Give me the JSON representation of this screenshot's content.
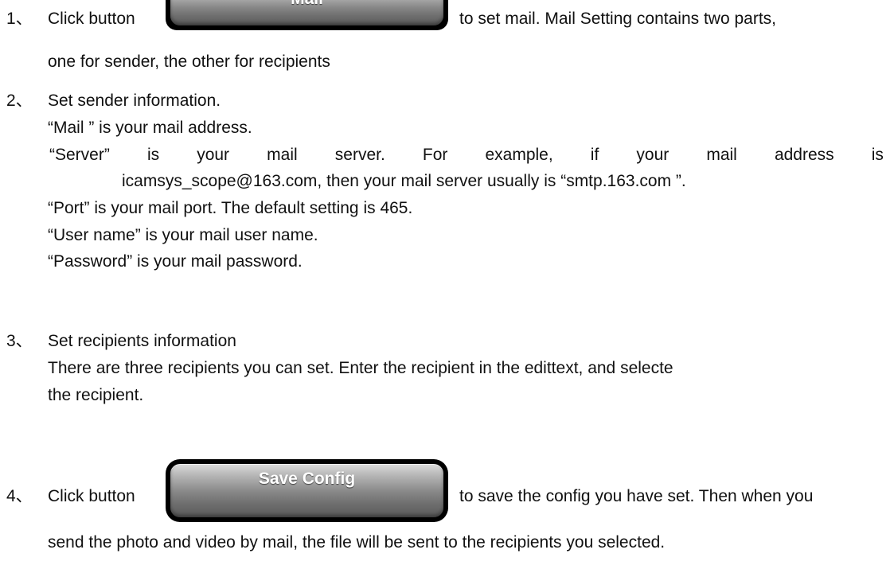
{
  "steps": [
    {
      "number": "1、",
      "lines": [
        "Click button",
        "to set mail. Mail Setting contains two parts,",
        "one for sender, the other for recipients"
      ],
      "button_label": "Mail"
    },
    {
      "number": "2、",
      "lines": [
        "Set sender information.",
        "“Mail ”   is your mail address.",
        "icamsys_scope@163.com, then your mail server usually is “smtp.163.com ”.",
        "“Port” is your mail port. The default setting is 465.",
        "“User name” is your mail user name.",
        "“Password” is your mail password."
      ],
      "server_line_words": [
        "“Server”",
        "is",
        "your",
        "mail",
        "server.",
        "For",
        "example,",
        "if",
        "your",
        "mail",
        "address",
        "is"
      ]
    },
    {
      "number": "3、",
      "lines": [
        "Set recipients information",
        "There are three recipients you can set. Enter the recipient in the edittext, and selecte",
        "the recipient."
      ]
    },
    {
      "number": "4、",
      "lines": [
        "Click button",
        "to save the config you have set. Then when you",
        "send the photo and video by mail, the file will be sent to the recipients you selected."
      ],
      "button_label": "Save Config"
    }
  ]
}
